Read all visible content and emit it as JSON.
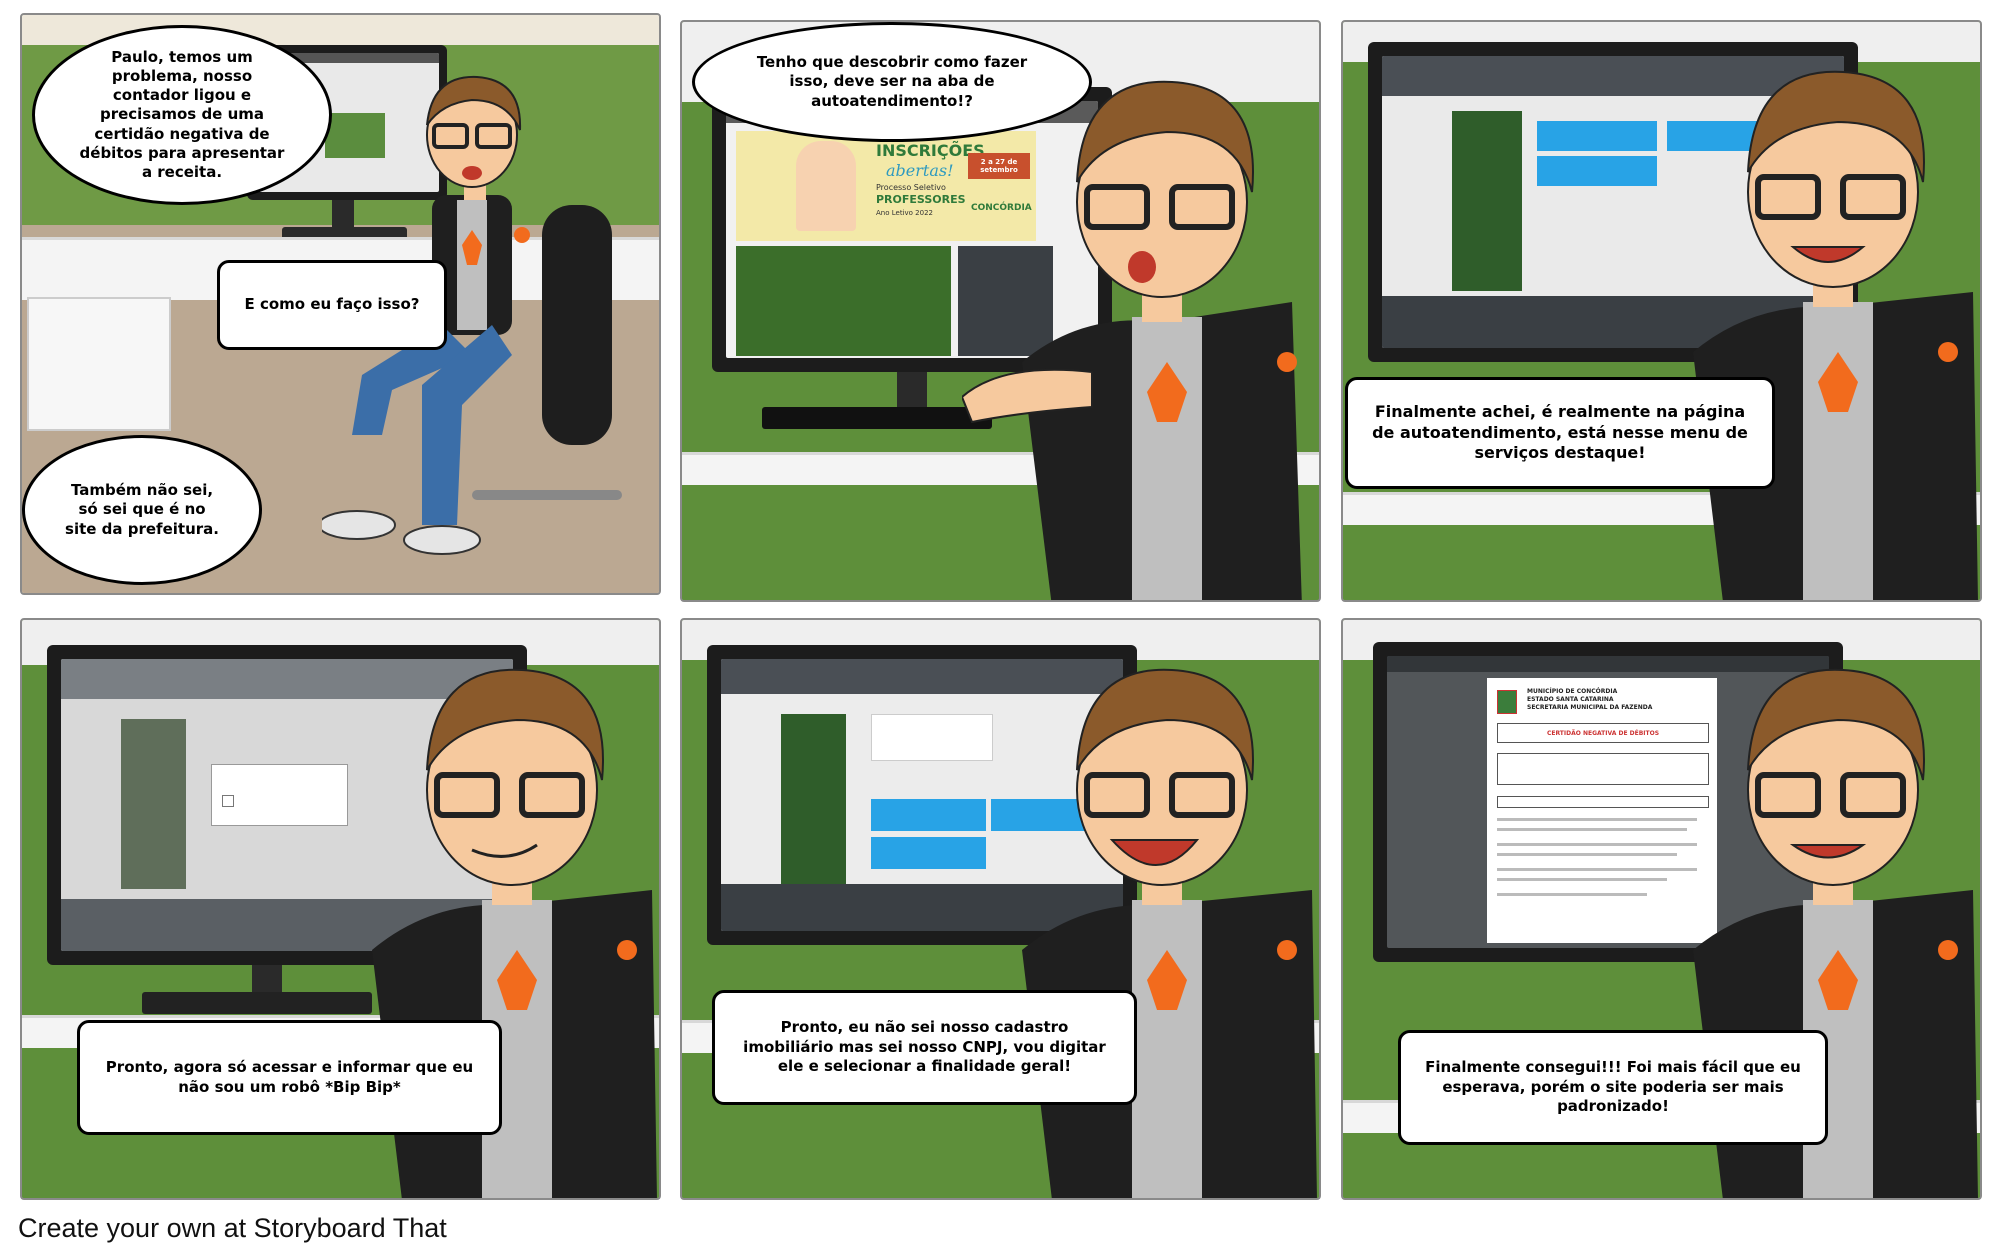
{
  "panels": [
    {
      "id": "p1",
      "captions": [
        "Paulo, temos um problema, nosso contador ligou e precisamos de uma certidão negativa de débitos para apresentar a receita.",
        "E como eu faço isso?",
        "Também não sei, só sei que é no site da prefeitura."
      ]
    },
    {
      "id": "p2",
      "captions": [
        "Tenho que descobrir como fazer isso, deve ser na aba de autoatendimento!?"
      ],
      "screen": {
        "banner_title": "INSCRIÇÕES",
        "banner_script": "abertas!",
        "banner_sub1": "Processo Seletivo",
        "banner_sub2": "PROFESSORES",
        "banner_year": "Ano Letivo 2022",
        "banner_date": "2 a 27 de setembro",
        "banner_brand": "CONCÓRDIA"
      }
    },
    {
      "id": "p3",
      "captions": [
        "Finalmente achei, é realmente na página de autoatendimento, está nesse menu de serviços destaque!"
      ]
    },
    {
      "id": "p4",
      "captions": [
        "Pronto, agora só acessar e informar que eu não sou um robô *Bip Bip*"
      ]
    },
    {
      "id": "p5",
      "captions": [
        "Pronto, eu não sei nosso cadastro imobiliário mas sei nosso CNPJ, vou digitar ele e selecionar a finalidade geral!"
      ]
    },
    {
      "id": "p6",
      "captions": [
        "Finalmente consegui!!! Foi mais fácil que eu esperava, porém o site poderia ser mais padronizado!"
      ],
      "document": {
        "header1": "MUNICÍPIO DE CONCÓRDIA",
        "header2": "ESTADO SANTA CATARINA",
        "header3": "SECRETARIA MUNICIPAL DA FAZENDA",
        "title": "CERTIDÃO NEGATIVA DE DÉBITOS"
      }
    }
  ],
  "footer": {
    "credit": "Create your own at Storyboard That"
  },
  "colors": {
    "wall_green": "#5e8f3a",
    "jacket": "#222222",
    "hair": "#8b5a2b",
    "skin": "#f6c99e",
    "accent_orange": "#f26b1d",
    "accent_blue": "#28a3e6"
  }
}
